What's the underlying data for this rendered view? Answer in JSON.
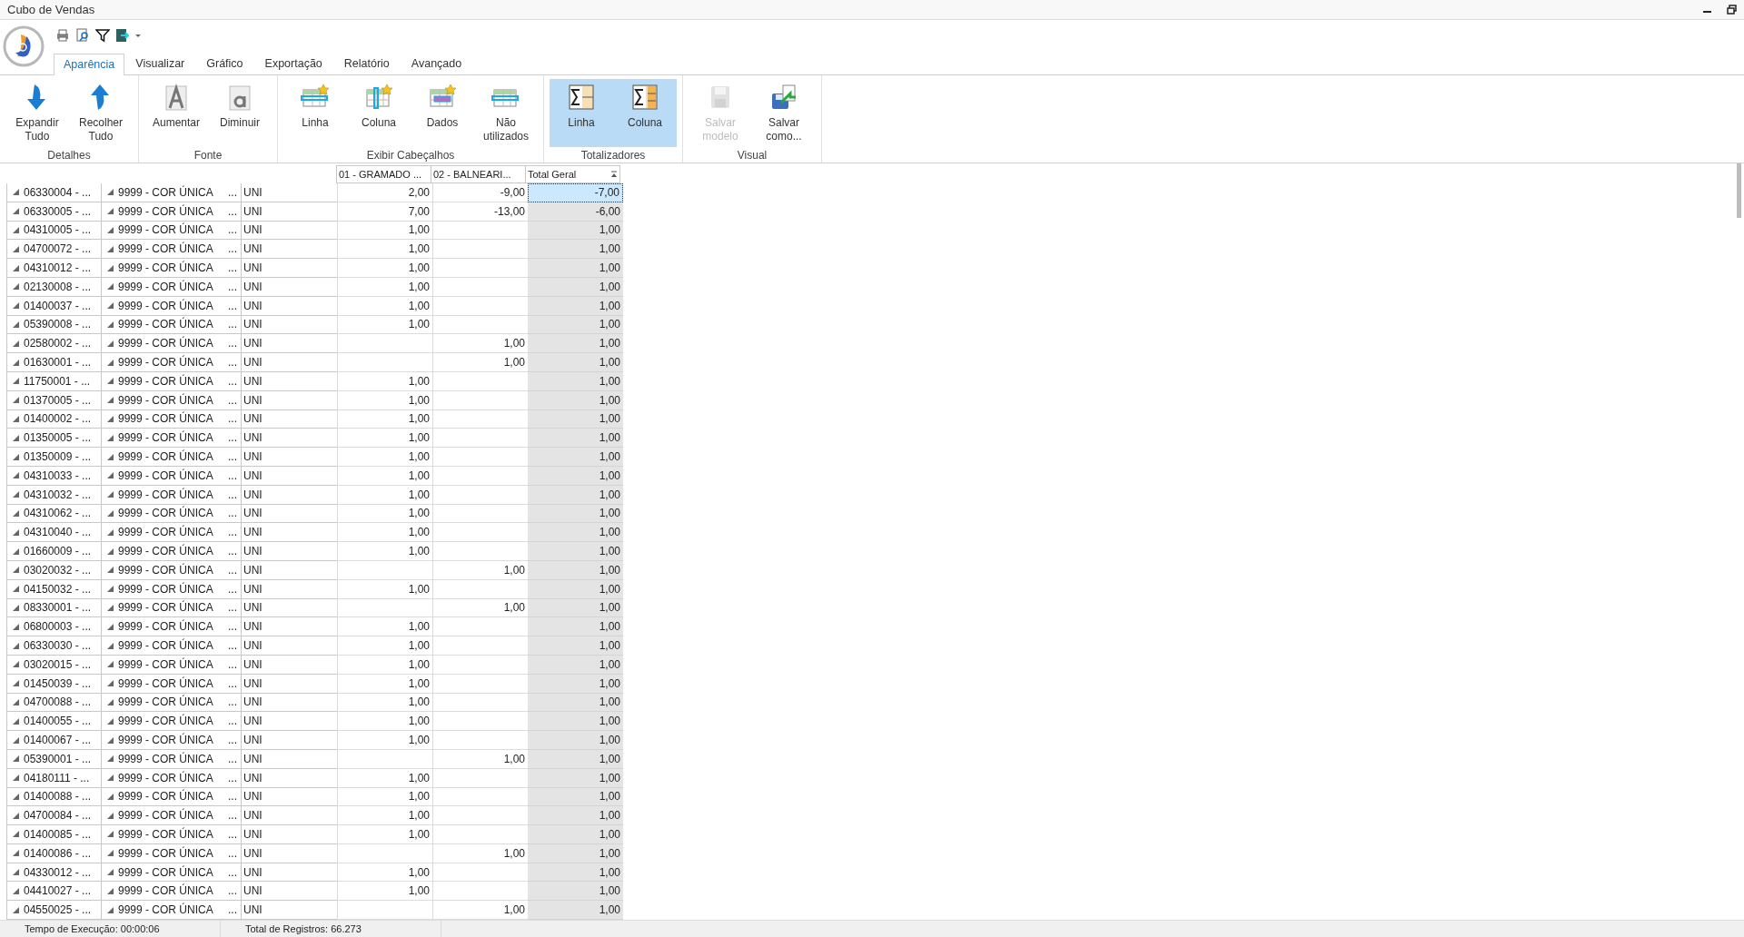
{
  "window": {
    "title": "Cubo de Vendas"
  },
  "tabs": [
    {
      "label": "Aparência",
      "selected": true
    },
    {
      "label": "Visualizar",
      "selected": false
    },
    {
      "label": "Gráfico",
      "selected": false
    },
    {
      "label": "Exportação",
      "selected": false
    },
    {
      "label": "Relatório",
      "selected": false
    },
    {
      "label": "Avançado",
      "selected": false
    }
  ],
  "ribbon": {
    "groups": [
      {
        "label": "Detalhes",
        "buttons": [
          {
            "kind": "expand",
            "label": "Expandir\nTudo",
            "disabled": false,
            "selected": false
          },
          {
            "kind": "collapse",
            "label": "Recolher\nTudo",
            "disabled": false,
            "selected": false
          }
        ]
      },
      {
        "label": "Fonte",
        "buttons": [
          {
            "kind": "font-up",
            "label": "Aumentar",
            "disabled": false,
            "selected": false
          },
          {
            "kind": "font-down",
            "label": "Diminuir",
            "disabled": false,
            "selected": false
          }
        ]
      },
      {
        "label": "Exibir Cabeçalhos",
        "buttons": [
          {
            "kind": "row-header",
            "label": "Linha",
            "disabled": false,
            "selected": false
          },
          {
            "kind": "col-header",
            "label": "Coluna",
            "disabled": false,
            "selected": false
          },
          {
            "kind": "data-header",
            "label": "Dados",
            "disabled": false,
            "selected": false
          },
          {
            "kind": "unused-header",
            "label": "Não\nutilizados",
            "disabled": false,
            "selected": false
          }
        ]
      },
      {
        "label": "Totalizadores",
        "buttons": [
          {
            "kind": "row-total",
            "label": "Linha",
            "disabled": false,
            "selected": true
          },
          {
            "kind": "col-total",
            "label": "Coluna",
            "disabled": false,
            "selected": true
          }
        ]
      },
      {
        "label": "Visual",
        "buttons": [
          {
            "kind": "save",
            "label": "Salvar\nmodelo",
            "disabled": true,
            "selected": false
          },
          {
            "kind": "save-as",
            "label": "Salvar\ncomo...",
            "disabled": false,
            "selected": false
          }
        ]
      }
    ]
  },
  "table": {
    "columns": [
      "01 - GRAMADO ...",
      "02 - BALNEARI...",
      "Total Geral"
    ],
    "rows": [
      {
        "product": "06330004 - ...",
        "variant": "9999 - COR ÚNICA",
        "more": "...",
        "unit": "UNI",
        "c1": "2,00",
        "c2": "-9,00",
        "total": "-7,00",
        "selected": true
      },
      {
        "product": "06330005 - ...",
        "variant": "9999 - COR ÚNICA",
        "more": "...",
        "unit": "UNI",
        "c1": "7,00",
        "c2": "-13,00",
        "total": "-6,00",
        "selected": false
      },
      {
        "product": "04310005 - ...",
        "variant": "9999 - COR ÚNICA",
        "more": "...",
        "unit": "UNI",
        "c1": "1,00",
        "c2": "",
        "total": "1,00",
        "selected": false
      },
      {
        "product": "04700072 - ...",
        "variant": "9999 - COR ÚNICA",
        "more": "...",
        "unit": "UNI",
        "c1": "1,00",
        "c2": "",
        "total": "1,00",
        "selected": false
      },
      {
        "product": "04310012 - ...",
        "variant": "9999 - COR ÚNICA",
        "more": "...",
        "unit": "UNI",
        "c1": "1,00",
        "c2": "",
        "total": "1,00",
        "selected": false
      },
      {
        "product": "02130008 - ...",
        "variant": "9999 - COR ÚNICA",
        "more": "...",
        "unit": "UNI",
        "c1": "1,00",
        "c2": "",
        "total": "1,00",
        "selected": false
      },
      {
        "product": "01400037 - ...",
        "variant": "9999 - COR ÚNICA",
        "more": "...",
        "unit": "UNI",
        "c1": "1,00",
        "c2": "",
        "total": "1,00",
        "selected": false
      },
      {
        "product": "05390008 - ...",
        "variant": "9999 - COR ÚNICA",
        "more": "...",
        "unit": "UNI",
        "c1": "1,00",
        "c2": "",
        "total": "1,00",
        "selected": false
      },
      {
        "product": "02580002 - ...",
        "variant": "9999 - COR ÚNICA",
        "more": "...",
        "unit": "UNI",
        "c1": "",
        "c2": "1,00",
        "total": "1,00",
        "selected": false
      },
      {
        "product": "01630001 - ...",
        "variant": "9999 - COR ÚNICA",
        "more": "...",
        "unit": "UNI",
        "c1": "",
        "c2": "1,00",
        "total": "1,00",
        "selected": false
      },
      {
        "product": "11750001 - ...",
        "variant": "9999 - COR ÚNICA",
        "more": "...",
        "unit": "UNI",
        "c1": "1,00",
        "c2": "",
        "total": "1,00",
        "selected": false
      },
      {
        "product": "01370005 - ...",
        "variant": "9999 - COR ÚNICA",
        "more": "...",
        "unit": "UNI",
        "c1": "1,00",
        "c2": "",
        "total": "1,00",
        "selected": false
      },
      {
        "product": "01400002 - ...",
        "variant": "9999 - COR ÚNICA",
        "more": "...",
        "unit": "UNI",
        "c1": "1,00",
        "c2": "",
        "total": "1,00",
        "selected": false
      },
      {
        "product": "01350005 - ...",
        "variant": "9999 - COR ÚNICA",
        "more": "...",
        "unit": "UNI",
        "c1": "1,00",
        "c2": "",
        "total": "1,00",
        "selected": false
      },
      {
        "product": "01350009 - ...",
        "variant": "9999 - COR ÚNICA",
        "more": "...",
        "unit": "UNI",
        "c1": "1,00",
        "c2": "",
        "total": "1,00",
        "selected": false
      },
      {
        "product": "04310033 - ...",
        "variant": "9999 - COR ÚNICA",
        "more": "...",
        "unit": "UNI",
        "c1": "1,00",
        "c2": "",
        "total": "1,00",
        "selected": false
      },
      {
        "product": "04310032 - ...",
        "variant": "9999 - COR ÚNICA",
        "more": "...",
        "unit": "UNI",
        "c1": "1,00",
        "c2": "",
        "total": "1,00",
        "selected": false
      },
      {
        "product": "04310062 - ...",
        "variant": "9999 - COR ÚNICA",
        "more": "...",
        "unit": "UNI",
        "c1": "1,00",
        "c2": "",
        "total": "1,00",
        "selected": false
      },
      {
        "product": "04310040 - ...",
        "variant": "9999 - COR ÚNICA",
        "more": "...",
        "unit": "UNI",
        "c1": "1,00",
        "c2": "",
        "total": "1,00",
        "selected": false
      },
      {
        "product": "01660009 - ...",
        "variant": "9999 - COR ÚNICA",
        "more": "...",
        "unit": "UNI",
        "c1": "1,00",
        "c2": "",
        "total": "1,00",
        "selected": false
      },
      {
        "product": "03020032 - ...",
        "variant": "9999 - COR ÚNICA",
        "more": "...",
        "unit": "UNI",
        "c1": "",
        "c2": "1,00",
        "total": "1,00",
        "selected": false
      },
      {
        "product": "04150032 - ...",
        "variant": "9999 - COR ÚNICA",
        "more": "...",
        "unit": "UNI",
        "c1": "1,00",
        "c2": "",
        "total": "1,00",
        "selected": false
      },
      {
        "product": "08330001 - ...",
        "variant": "9999 - COR ÚNICA",
        "more": "...",
        "unit": "UNI",
        "c1": "",
        "c2": "1,00",
        "total": "1,00",
        "selected": false
      },
      {
        "product": "06800003 - ...",
        "variant": "9999 - COR ÚNICA",
        "more": "...",
        "unit": "UNI",
        "c1": "1,00",
        "c2": "",
        "total": "1,00",
        "selected": false
      },
      {
        "product": "06330030 - ...",
        "variant": "9999 - COR ÚNICA",
        "more": "...",
        "unit": "UNI",
        "c1": "1,00",
        "c2": "",
        "total": "1,00",
        "selected": false
      },
      {
        "product": "03020015 - ...",
        "variant": "9999 - COR ÚNICA",
        "more": "...",
        "unit": "UNI",
        "c1": "1,00",
        "c2": "",
        "total": "1,00",
        "selected": false
      },
      {
        "product": "01450039 - ...",
        "variant": "9999 - COR ÚNICA",
        "more": "...",
        "unit": "UNI",
        "c1": "1,00",
        "c2": "",
        "total": "1,00",
        "selected": false
      },
      {
        "product": "04700088 - ...",
        "variant": "9999 - COR ÚNICA",
        "more": "...",
        "unit": "UNI",
        "c1": "1,00",
        "c2": "",
        "total": "1,00",
        "selected": false
      },
      {
        "product": "01400055 - ...",
        "variant": "9999 - COR ÚNICA",
        "more": "...",
        "unit": "UNI",
        "c1": "1,00",
        "c2": "",
        "total": "1,00",
        "selected": false
      },
      {
        "product": "01400067 - ...",
        "variant": "9999 - COR ÚNICA",
        "more": "...",
        "unit": "UNI",
        "c1": "1,00",
        "c2": "",
        "total": "1,00",
        "selected": false
      },
      {
        "product": "05390001 - ...",
        "variant": "9999 - COR ÚNICA",
        "more": "...",
        "unit": "UNI",
        "c1": "",
        "c2": "1,00",
        "total": "1,00",
        "selected": false
      },
      {
        "product": "04180111 - ...",
        "variant": "9999 - COR ÚNICA",
        "more": "...",
        "unit": "UNI",
        "c1": "1,00",
        "c2": "",
        "total": "1,00",
        "selected": false
      },
      {
        "product": "01400088 - ...",
        "variant": "9999 - COR ÚNICA",
        "more": "...",
        "unit": "UNI",
        "c1": "1,00",
        "c2": "",
        "total": "1,00",
        "selected": false
      },
      {
        "product": "04700084 - ...",
        "variant": "9999 - COR ÚNICA",
        "more": "...",
        "unit": "UNI",
        "c1": "1,00",
        "c2": "",
        "total": "1,00",
        "selected": false
      },
      {
        "product": "01400085 - ...",
        "variant": "9999 - COR ÚNICA",
        "more": "...",
        "unit": "UNI",
        "c1": "1,00",
        "c2": "",
        "total": "1,00",
        "selected": false
      },
      {
        "product": "01400086 - ...",
        "variant": "9999 - COR ÚNICA",
        "more": "...",
        "unit": "UNI",
        "c1": "",
        "c2": "1,00",
        "total": "1,00",
        "selected": false
      },
      {
        "product": "04330012 - ...",
        "variant": "9999 - COR ÚNICA",
        "more": "...",
        "unit": "UNI",
        "c1": "1,00",
        "c2": "",
        "total": "1,00",
        "selected": false
      },
      {
        "product": "04410027 - ...",
        "variant": "9999 - COR ÚNICA",
        "more": "...",
        "unit": "UNI",
        "c1": "1,00",
        "c2": "",
        "total": "1,00",
        "selected": false
      },
      {
        "product": "04550025 - ...",
        "variant": "9999 - COR ÚNICA",
        "more": "...",
        "unit": "UNI",
        "c1": "",
        "c2": "1,00",
        "total": "1,00",
        "selected": false
      }
    ]
  },
  "status_bar": [
    "Tempo de Execução: 00:00:06",
    "Total de Registros: 66.273"
  ]
}
